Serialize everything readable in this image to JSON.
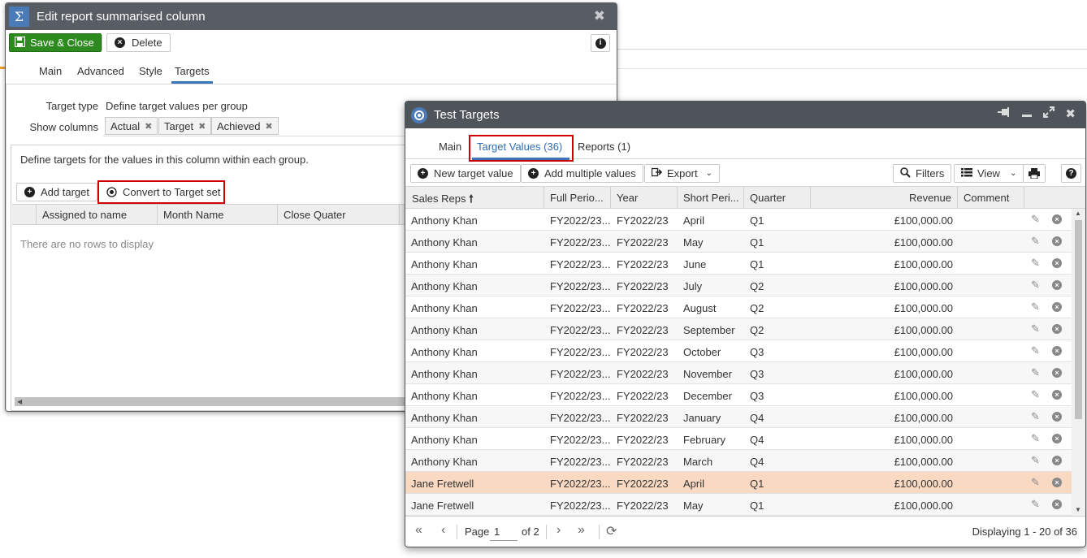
{
  "edit_window": {
    "title": "Edit report summarised column",
    "toolbar": {
      "save_close": "Save & Close",
      "delete": "Delete"
    },
    "tabs": [
      "Main",
      "Advanced",
      "Style",
      "Targets"
    ],
    "active_tab": "Targets",
    "target_type_label": "Target type",
    "target_type_value": "Define target values per group",
    "show_columns_label": "Show columns",
    "show_columns": [
      "Actual",
      "Target",
      "Achieved"
    ],
    "description": "Define targets for the values in this column within each group.",
    "add_target": "Add target",
    "convert_to_target_set": "Convert to Target set",
    "columns": [
      "Assigned to name",
      "Month Name",
      "Close Quater"
    ],
    "empty_message": "There are no rows to display"
  },
  "targets_window": {
    "title": "Test Targets",
    "tabs": [
      {
        "label": "Main"
      },
      {
        "label": "Target Values (36)"
      },
      {
        "label": "Reports (1)"
      }
    ],
    "toolbar": {
      "new_target_value": "New target value",
      "add_multiple_values": "Add multiple values",
      "export": "Export",
      "filters": "Filters",
      "view": "View"
    },
    "columns": {
      "sales_reps": "Sales Reps",
      "full_period": "Full Perio...",
      "year": "Year",
      "short_period": "Short Peri...",
      "quarter": "Quarter",
      "revenue": "Revenue",
      "comment": "Comment"
    },
    "rows": [
      {
        "rep": "Anthony Khan",
        "full_period": "FY2022/23...",
        "year": "FY2022/23",
        "short_period": "April",
        "quarter": "Q1",
        "revenue": "£100,000.00"
      },
      {
        "rep": "Anthony Khan",
        "full_period": "FY2022/23...",
        "year": "FY2022/23",
        "short_period": "May",
        "quarter": "Q1",
        "revenue": "£100,000.00"
      },
      {
        "rep": "Anthony Khan",
        "full_period": "FY2022/23...",
        "year": "FY2022/23",
        "short_period": "June",
        "quarter": "Q1",
        "revenue": "£100,000.00"
      },
      {
        "rep": "Anthony Khan",
        "full_period": "FY2022/23...",
        "year": "FY2022/23",
        "short_period": "July",
        "quarter": "Q2",
        "revenue": "£100,000.00"
      },
      {
        "rep": "Anthony Khan",
        "full_period": "FY2022/23...",
        "year": "FY2022/23",
        "short_period": "August",
        "quarter": "Q2",
        "revenue": "£100,000.00"
      },
      {
        "rep": "Anthony Khan",
        "full_period": "FY2022/23...",
        "year": "FY2022/23",
        "short_period": "September",
        "quarter": "Q2",
        "revenue": "£100,000.00"
      },
      {
        "rep": "Anthony Khan",
        "full_period": "FY2022/23...",
        "year": "FY2022/23",
        "short_period": "October",
        "quarter": "Q3",
        "revenue": "£100,000.00"
      },
      {
        "rep": "Anthony Khan",
        "full_period": "FY2022/23...",
        "year": "FY2022/23",
        "short_period": "November",
        "quarter": "Q3",
        "revenue": "£100,000.00"
      },
      {
        "rep": "Anthony Khan",
        "full_period": "FY2022/23...",
        "year": "FY2022/23",
        "short_period": "December",
        "quarter": "Q3",
        "revenue": "£100,000.00"
      },
      {
        "rep": "Anthony Khan",
        "full_period": "FY2022/23...",
        "year": "FY2022/23",
        "short_period": "January",
        "quarter": "Q4",
        "revenue": "£100,000.00"
      },
      {
        "rep": "Anthony Khan",
        "full_period": "FY2022/23...",
        "year": "FY2022/23",
        "short_period": "February",
        "quarter": "Q4",
        "revenue": "£100,000.00"
      },
      {
        "rep": "Anthony Khan",
        "full_period": "FY2022/23...",
        "year": "FY2022/23",
        "short_period": "March",
        "quarter": "Q4",
        "revenue": "£100,000.00"
      },
      {
        "rep": "Jane Fretwell",
        "full_period": "FY2022/23...",
        "year": "FY2022/23",
        "short_period": "April",
        "quarter": "Q1",
        "revenue": "£100,000.00"
      },
      {
        "rep": "Jane Fretwell",
        "full_period": "FY2022/23...",
        "year": "FY2022/23",
        "short_period": "May",
        "quarter": "Q1",
        "revenue": "£100,000.00"
      }
    ],
    "highlighted_row": 12,
    "pager": {
      "page_label": "Page",
      "page_value": "1",
      "of_label": "of 2",
      "display_info": "Displaying 1 - 20 of 36"
    }
  },
  "colors": {
    "save_green": "#2d8a1f",
    "titlebar": "#585d64",
    "accent_blue": "#3a75b8",
    "highlight_row": "#fad9c2",
    "red_outline": "#d00000"
  }
}
